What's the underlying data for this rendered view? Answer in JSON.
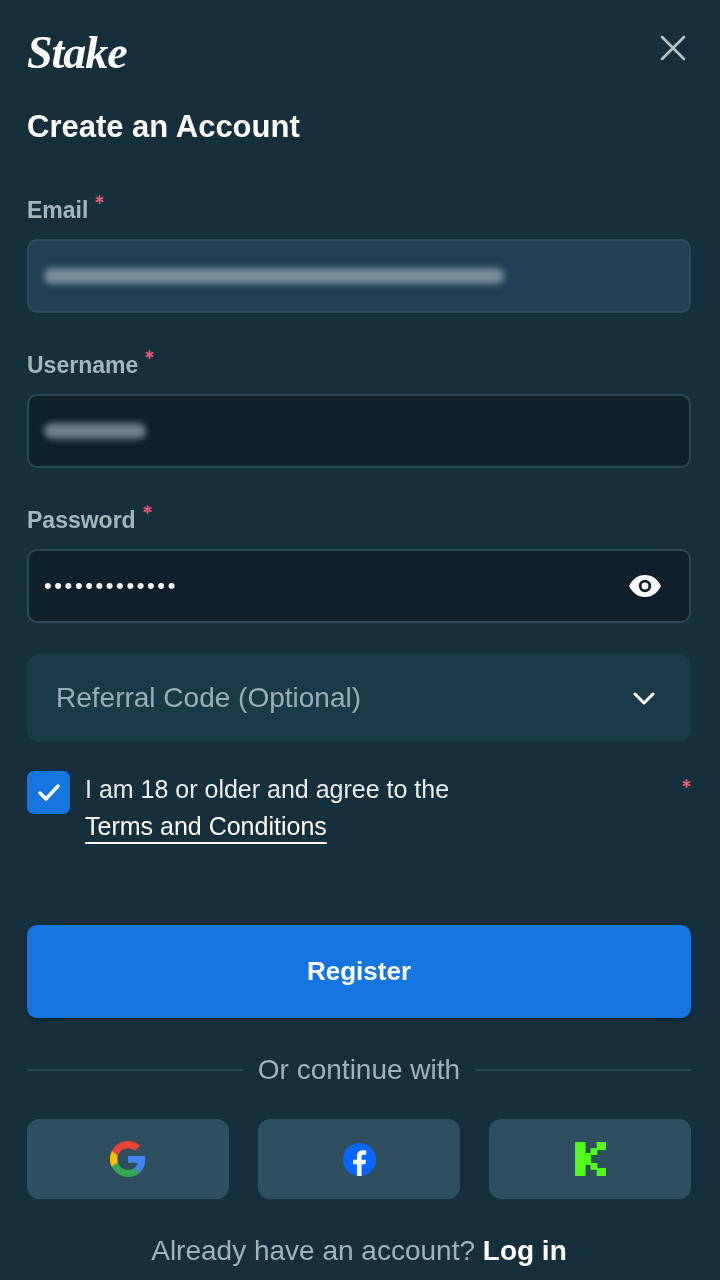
{
  "header": {
    "logo": "Stake",
    "title": "Create an Account"
  },
  "fields": [
    {
      "kind": "email",
      "label": "Email",
      "required": true,
      "autofilled": true,
      "value_blurred": true
    },
    {
      "kind": "username",
      "label": "Username",
      "required": true,
      "autofilled": false,
      "value_blurred": true
    },
    {
      "kind": "password",
      "label": "Password",
      "required": true,
      "autofilled": false,
      "value": "•••••••••••••"
    }
  ],
  "referral": {
    "label": "Referral Code (Optional)",
    "expanded": false
  },
  "consent": {
    "checked": true,
    "required": true,
    "text": "I am 18 or older and agree to the",
    "link": "Terms and Conditions"
  },
  "register_button": "Register",
  "divider_text": "Or continue with",
  "social_buttons": [
    {
      "kind": "google"
    },
    {
      "kind": "facebook"
    },
    {
      "kind": "kick"
    }
  ],
  "footer": {
    "text": "Already have an account?",
    "link": "Log in"
  }
}
